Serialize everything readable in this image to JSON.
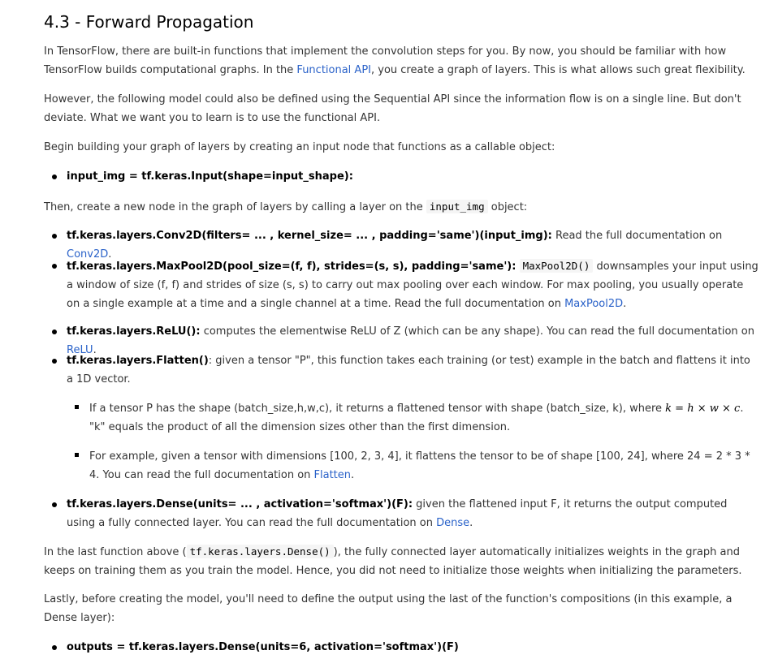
{
  "title": "4.3 - Forward Propagation",
  "p1": {
    "before": "In TensorFlow, there are built-in functions that implement the convolution steps for you. By now, you should be familiar with how TensorFlow builds computational graphs. In the ",
    "link": "Functional API",
    "after": ", you create a graph of layers. This is what allows such great flexibility."
  },
  "p2": "However, the following model could also be defined using the Sequential API since the information flow is on a single line. But don't deviate. What we want you to learn is to use the functional API.",
  "p3": "Begin building your graph of layers by creating an input node that functions as a callable object:",
  "bullet_input": "input_img = tf.keras.Input(shape=input_shape):",
  "p4": {
    "before": "Then, create a new node in the graph of layers by calling a layer on the ",
    "code": "input_img",
    "after": " object:"
  },
  "conv": {
    "bold": "tf.keras.layers.Conv2D(filters= ... , kernel_size= ... , padding='same')(input_img):",
    "text": " Read the full documentation on ",
    "link": "Conv2D",
    "end": "."
  },
  "maxpool": {
    "bold": "tf.keras.layers.MaxPool2D(pool_size=(f, f), strides=(s, s), padding='same'):",
    "code": "MaxPool2D()",
    "text": " downsamples your input using a window of size (f, f) and strides of size (s, s) to carry out max pooling over each window. For max pooling, you usually operate on a single example at a time and a single channel at a time. Read the full documentation on ",
    "link": "MaxPool2D",
    "end": "."
  },
  "relu": {
    "bold": "tf.keras.layers.ReLU():",
    "text": " computes the elementwise ReLU of Z (which can be any shape). You can read the full documentation on ",
    "link": "ReLU",
    "end": "."
  },
  "flatten": {
    "bold": "tf.keras.layers.Flatten()",
    "text": ": given a tensor \"P\", this function takes each training (or test) example in the batch and flattens it into a 1D vector.",
    "sub1": {
      "before": "If a tensor P has the shape (batch_size,h,w,c), it returns a flattened tensor with shape (batch_size, k), where ",
      "math": "k = h × w × c",
      "after": ". \"k\" equals the product of all the dimension sizes other than the first dimension."
    },
    "sub2": {
      "before": "For example, given a tensor with dimensions [100, 2, 3, 4], it flattens the tensor to be of shape [100, 24], where 24 = 2 * 3 * 4. You can read the full documentation on ",
      "link": "Flatten",
      "end": "."
    }
  },
  "dense": {
    "bold": "tf.keras.layers.Dense(units= ... , activation='softmax')(F):",
    "text": " given the flattened input F, it returns the output computed using a fully connected layer. You can read the full documentation on ",
    "link": "Dense",
    "end": "."
  },
  "p5": {
    "before": "In the last function above (",
    "code": "tf.keras.layers.Dense()",
    "after": "), the fully connected layer automatically initializes weights in the graph and keeps on training them as you train the model. Hence, you did not need to initialize those weights when initializing the parameters."
  },
  "p6": "Lastly, before creating the model, you'll need to define the output using the last of the function's compositions (in this example, a Dense layer):",
  "bullet_outputs": "outputs = tf.keras.layers.Dense(units=6, activation='softmax')(F)"
}
